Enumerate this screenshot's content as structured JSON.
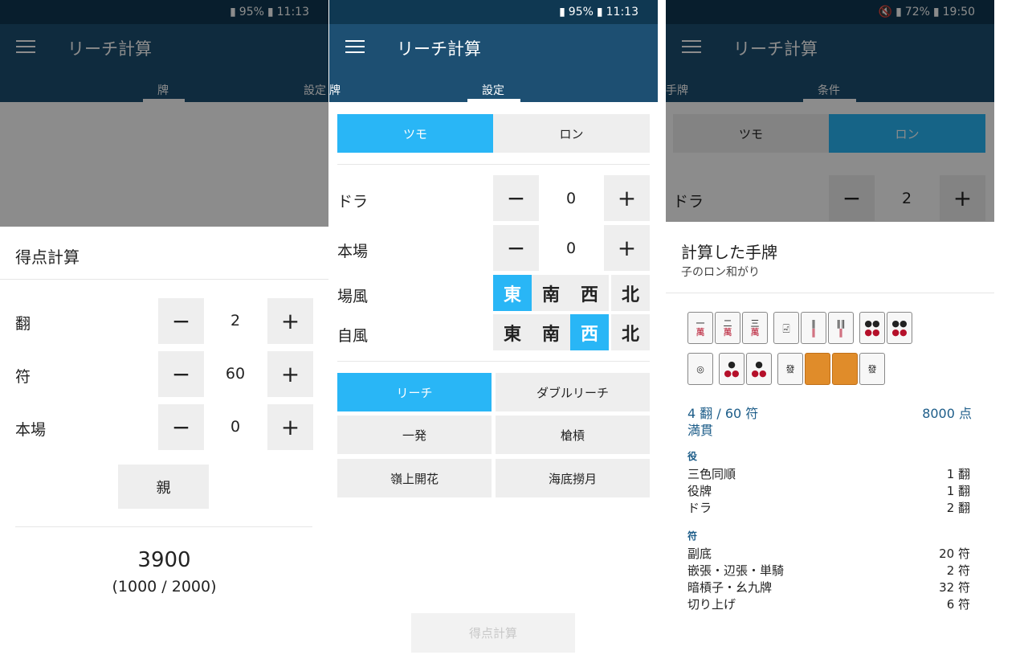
{
  "status": {
    "left_battery": "95%",
    "left_time": "11:13",
    "right_battery": "72%",
    "right_time": "19:50"
  },
  "app": {
    "title": "リーチ計算"
  },
  "tabs": {
    "hai": "牌",
    "settei": "設定",
    "tehai": "手牌",
    "jouken": "条件"
  },
  "score_sheet": {
    "title": "得点計算",
    "han_label": "翻",
    "han_value": "2",
    "fu_label": "符",
    "fu_value": "60",
    "honba_label": "本場",
    "honba_value": "0",
    "minus": "−",
    "plus": "+",
    "oya_button": "親",
    "points": "3900",
    "split": "(1000 / 2000)"
  },
  "settings": {
    "tsumo": "ツモ",
    "ron": "ロン",
    "dora_label": "ドラ",
    "dora_value": "0",
    "honba_label": "本場",
    "honba_value": "0",
    "bakaze_label": "場風",
    "jikaze_label": "自風",
    "winds": [
      "東",
      "南",
      "西",
      "北"
    ],
    "bakaze_selected": "東",
    "jikaze_selected": "西",
    "riichi": "リーチ",
    "double_riichi": "ダブルリーチ",
    "ippatsu": "一発",
    "chankan": "槍槓",
    "rinshan": "嶺上開花",
    "haitei": "海底撈月",
    "calc_button": "得点計算"
  },
  "result": {
    "dora_value": "2",
    "title": "計算した手牌",
    "subtitle": "子のロン和がり",
    "han_fu": "4 翻 / 60 符",
    "points": "8000 点",
    "limit": "満貫",
    "yaku_header": "役",
    "yaku": [
      {
        "name": "三色同順",
        "value": "1 翻"
      },
      {
        "name": "役牌",
        "value": "1 翻"
      },
      {
        "name": "ドラ",
        "value": "2 翻"
      }
    ],
    "fu_header": "符",
    "fu": [
      {
        "name": "副底",
        "value": "20 符"
      },
      {
        "name": "嵌張・辺張・単騎",
        "value": "2 符"
      },
      {
        "name": "暗槓子・幺九牌",
        "value": "32 符"
      },
      {
        "name": "切り上げ",
        "value": "6 符"
      }
    ],
    "tiles_row1": [
      {
        "t": "一",
        "s": "萬"
      },
      {
        "t": "二",
        "s": "萬"
      },
      {
        "t": "三",
        "s": "萬"
      },
      {
        "t": "🀐",
        "s": ""
      },
      {
        "t": "‖",
        "s": "‖"
      },
      {
        "t": "‖‖",
        "s": "‖"
      },
      {
        "t": "●●",
        "s": "●●"
      },
      {
        "t": "●●",
        "s": "●●"
      }
    ],
    "tiles_row2": [
      {
        "t": "◎",
        "s": ""
      },
      {
        "t": "●",
        "s": "●●"
      },
      {
        "t": "●",
        "s": "●●"
      },
      {
        "t": "發",
        "s": ""
      },
      {
        "t": "",
        "s": ""
      },
      {
        "t": "",
        "s": ""
      },
      {
        "t": "發",
        "s": ""
      }
    ]
  }
}
